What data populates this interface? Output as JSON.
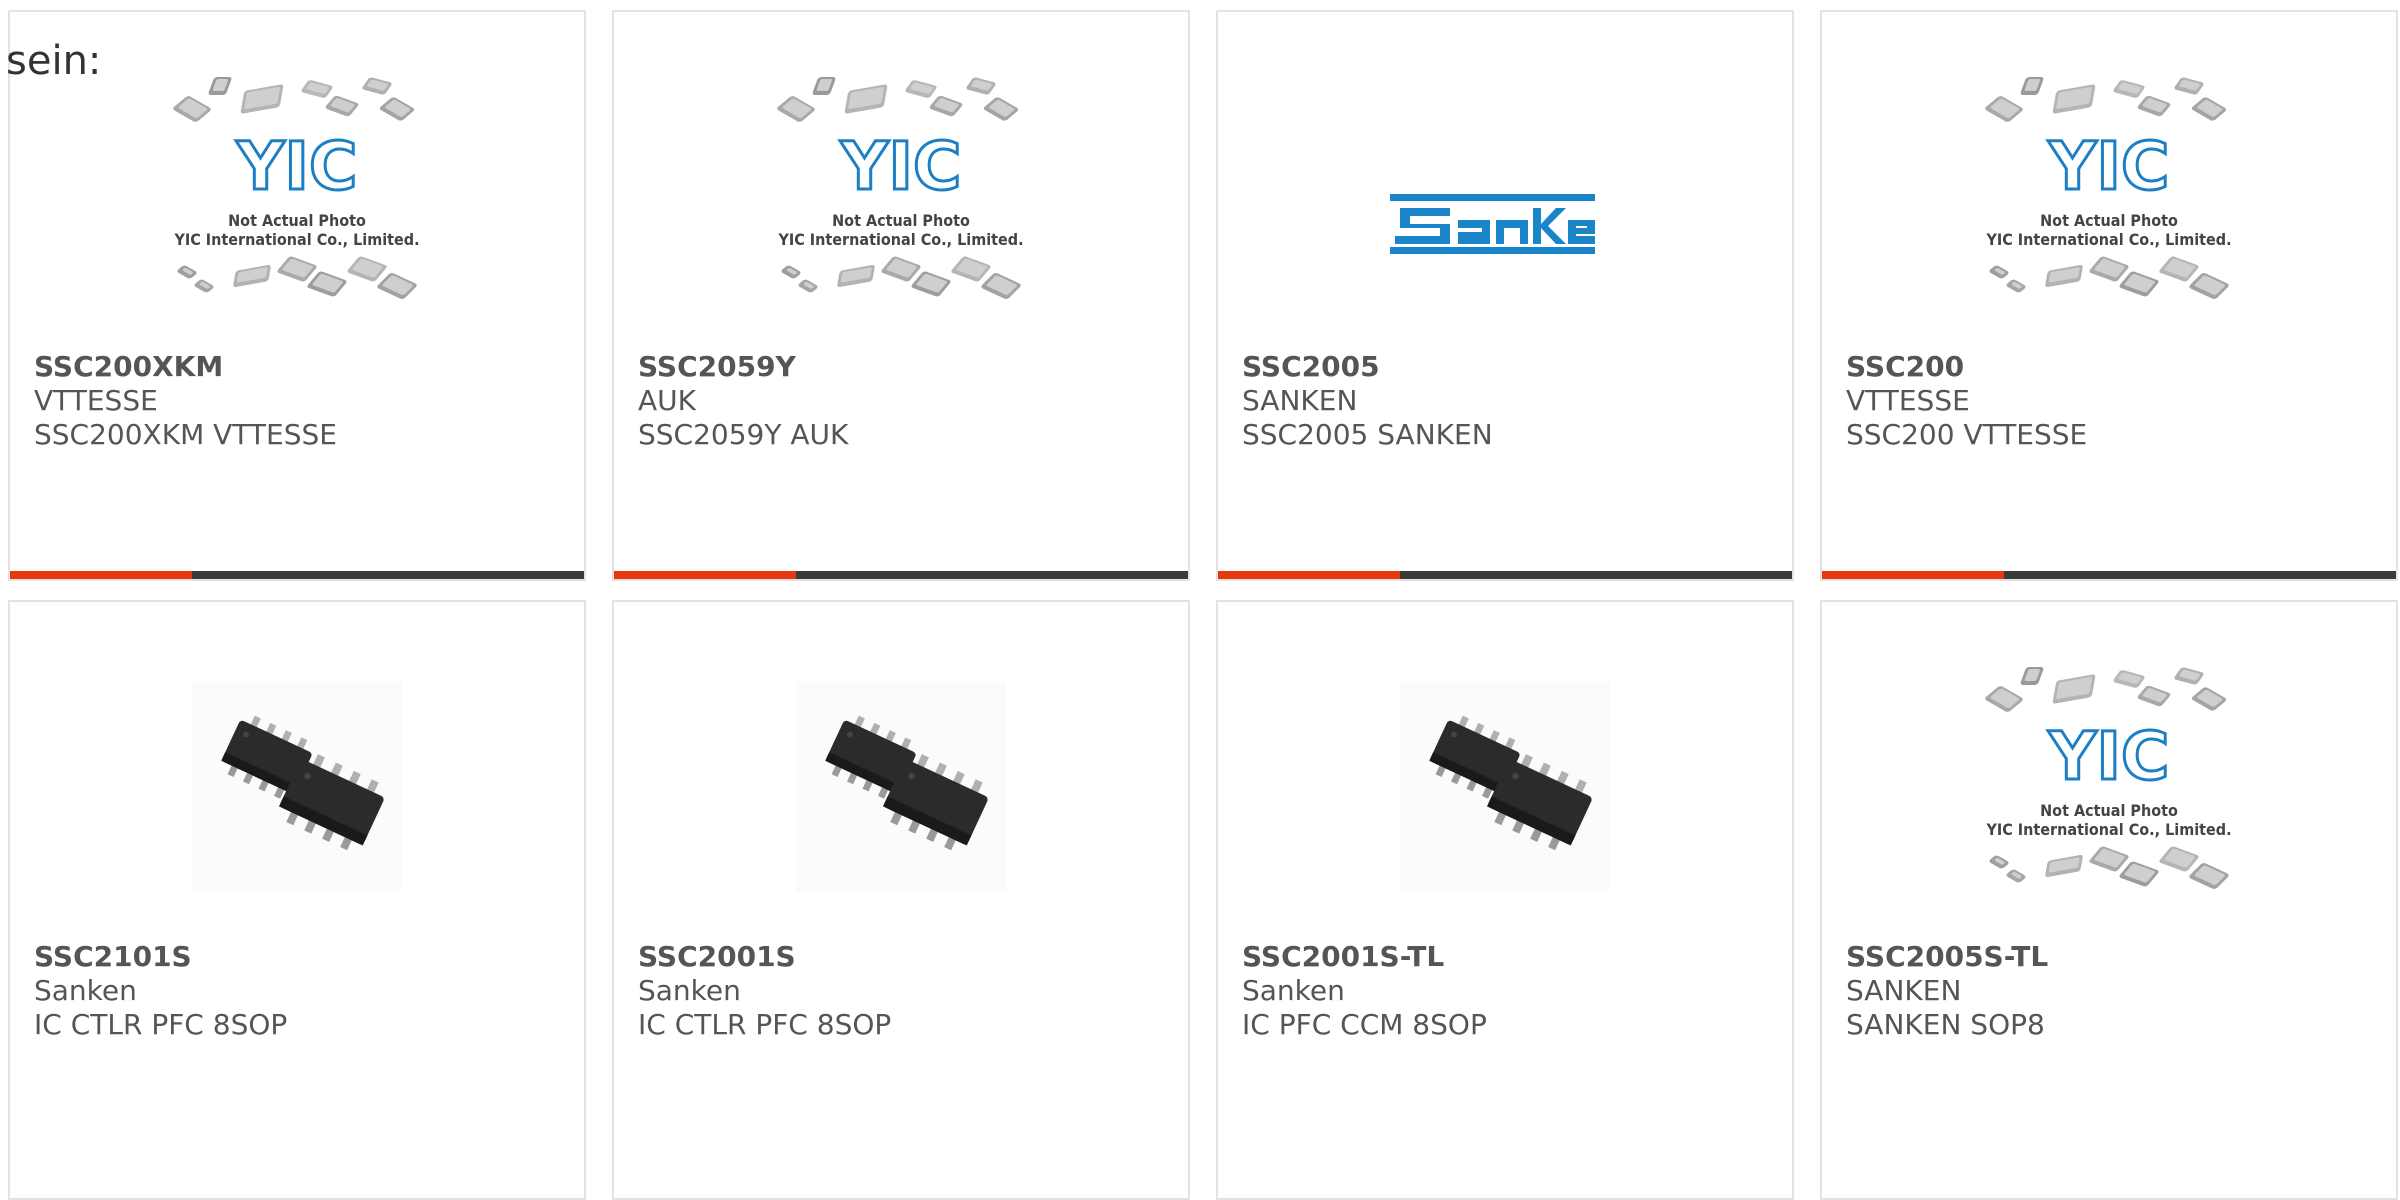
{
  "intro_text": "sein:",
  "yic_logo": {
    "label": "YIC",
    "caption_line1": "Not Actual Photo",
    "caption_line2": "YIC International Co., Limited."
  },
  "sanken_logo": {
    "label": "SanKen"
  },
  "colors": {
    "accent": "#e8380d",
    "bar": "#3a3a3a",
    "border": "#e3e3e3",
    "yic_blue": "#1c7fc4",
    "sanken_blue": "#1a85c8"
  },
  "products": [
    {
      "part": "SSC200XKM",
      "maker": "VTTESSE",
      "desc": "SSC200XKM VTTESSE",
      "image": "yic-placeholder"
    },
    {
      "part": "SSC2059Y",
      "maker": "AUK",
      "desc": "SSC2059Y AUK",
      "image": "yic-placeholder"
    },
    {
      "part": "SSC2005",
      "maker": "SANKEN",
      "desc": "SSC2005 SANKEN",
      "image": "sanken-logo"
    },
    {
      "part": "SSC200",
      "maker": "VTTESSE",
      "desc": "SSC200 VTTESSE",
      "image": "yic-placeholder"
    },
    {
      "part": "SSC2101S",
      "maker": "Sanken",
      "desc": "IC CTLR PFC 8SOP",
      "image": "sop8-chip"
    },
    {
      "part": "SSC2001S",
      "maker": "Sanken",
      "desc": "IC CTLR PFC 8SOP",
      "image": "sop8-chip"
    },
    {
      "part": "SSC2001S-TL",
      "maker": "Sanken",
      "desc": "IC PFC CCM 8SOP",
      "image": "sop8-chip"
    },
    {
      "part": "SSC2005S-TL",
      "maker": "SANKEN",
      "desc": "SANKEN SOP8",
      "image": "yic-placeholder"
    }
  ]
}
